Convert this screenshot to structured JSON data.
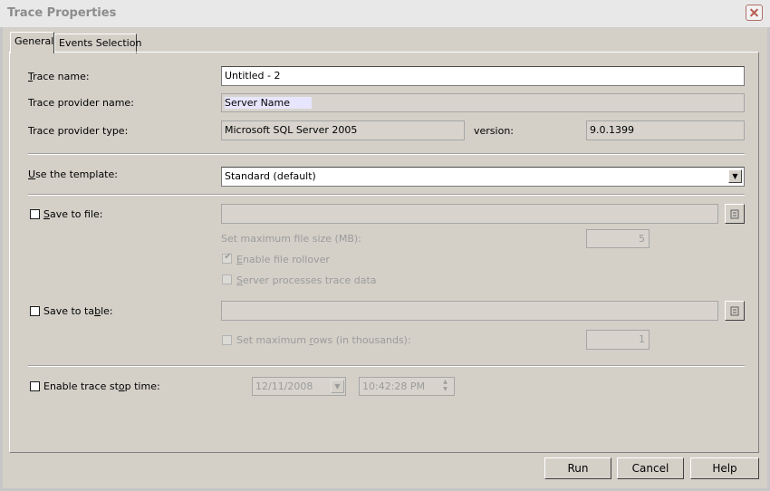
{
  "window": {
    "title": "Trace Properties"
  },
  "tabs": [
    {
      "label": "General",
      "active": true
    },
    {
      "label": "Events Selection",
      "active": false
    }
  ],
  "general": {
    "trace_name": {
      "label_prefix": "T",
      "label_rest": "race name:",
      "value": "Untitled - 2"
    },
    "provider_name": {
      "label": "Trace provider name:",
      "value": "Server Name"
    },
    "provider_type": {
      "label": "Trace provider type:",
      "value": "Microsoft SQL Server 2005",
      "version_label": "version:",
      "version_value": "9.0.1399"
    },
    "template": {
      "label_prefix": "U",
      "label_rest": "se the template:",
      "value": "Standard (default)"
    },
    "save_to_file": {
      "label_prefix": "S",
      "label_rest": "ave to file:",
      "checked": false,
      "value": "",
      "max_size_label": "Set maximum file size (MB):",
      "max_size_value": "5",
      "rollover_label_prefix": "E",
      "rollover_label_rest": "nable file rollover",
      "rollover_checked": true,
      "server_processes_prefix": "S",
      "server_processes_rest": "erver processes trace data",
      "server_processes_checked": false
    },
    "save_to_table": {
      "label_a": "Save to ta",
      "label_u": "b",
      "label_b": "le:",
      "checked": false,
      "value": "",
      "max_rows_a": "Set maximum ",
      "max_rows_u": "r",
      "max_rows_b": "ows (in thousands):",
      "max_rows_checked": false,
      "max_rows_value": "1"
    },
    "stop_time": {
      "label_a": "Enable trace st",
      "label_u": "o",
      "label_b": "p time:",
      "checked": false,
      "date": "12/11/2008",
      "time": "10:42:28 PM"
    }
  },
  "buttons": {
    "run": "Run",
    "cancel": "Cancel",
    "help": "Help"
  },
  "colors": {
    "dialog_bg": "#d4d0c8",
    "disabled_text": "#9b9b9b",
    "highlight": "#e8e6ff"
  },
  "icons": {
    "close": "close-icon",
    "dropdown": "chevron-down-icon",
    "browse": "browse-icon",
    "spin": "spin-arrows-icon",
    "check": "checkmark-icon"
  }
}
